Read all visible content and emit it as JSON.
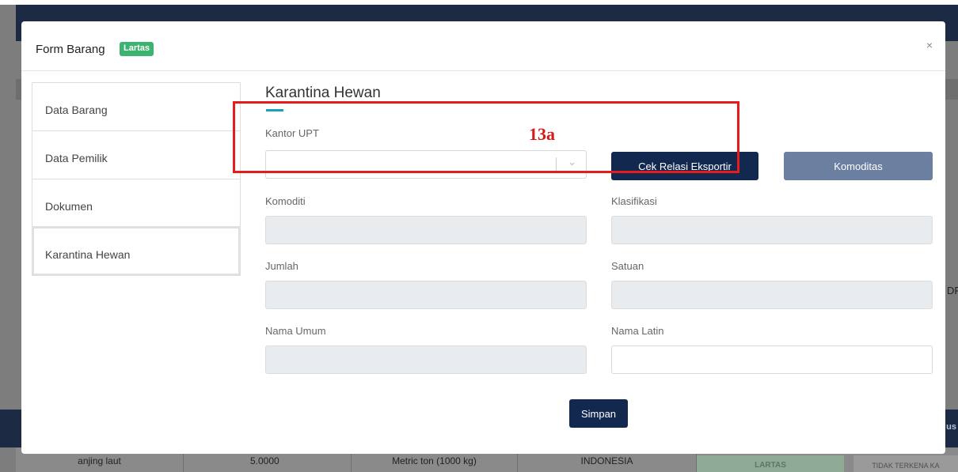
{
  "background": {
    "side_text": "DF",
    "footer_text": "us",
    "table_row": [
      "anjing laut",
      "5.0000",
      "Metric ton (1000 kg)",
      "INDONESIA"
    ],
    "badge_lartas": "LARTAS",
    "badge_tidak": "TIDAK TERKENA KA"
  },
  "modal": {
    "title": "Form Barang",
    "badge": "Lartas",
    "close": "×"
  },
  "side_nav": {
    "items": [
      {
        "label": "Data Barang"
      },
      {
        "label": "Data Pemilik"
      },
      {
        "label": "Dokumen"
      },
      {
        "label": "Karantina Hewan"
      }
    ],
    "active_index": 3
  },
  "section": {
    "title": "Karantina Hewan"
  },
  "form": {
    "kantor_upt_label": "Kantor UPT",
    "kantor_upt_value": "",
    "cek_relasi_button": "Cek Relasi Eksportir",
    "komoditas_button": "Komoditas",
    "komoditi_label": "Komoditi",
    "klasifikasi_label": "Klasifikasi",
    "jumlah_label": "Jumlah",
    "satuan_label": "Satuan",
    "nama_umum_label": "Nama Umum",
    "nama_latin_label": "Nama Latin",
    "simpan_button": "Simpan"
  },
  "annotation": {
    "label": "13a",
    "color": "#e61b1b"
  }
}
